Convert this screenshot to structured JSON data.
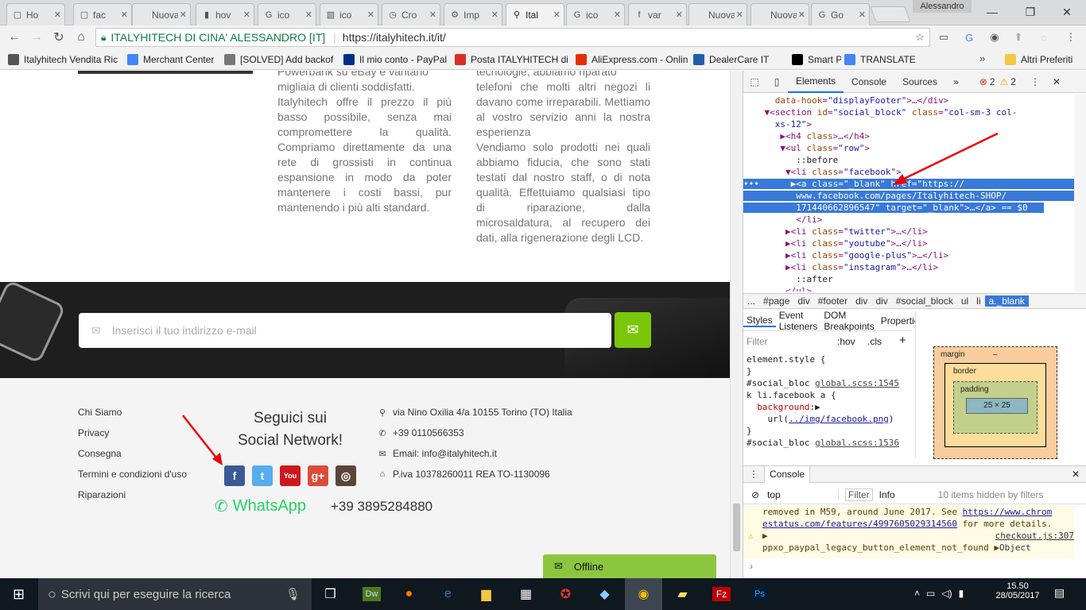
{
  "tabs": [
    {
      "label": "Ho",
      "icon": "page-icon",
      "fav": "▢"
    },
    {
      "label": "fac",
      "icon": "page-icon",
      "fav": "▢"
    },
    {
      "label": "Nuova",
      "icon": "blank-icon",
      "fav": ""
    },
    {
      "label": "hov",
      "icon": "chart-icon",
      "fav": "▮"
    },
    {
      "label": "ico",
      "icon": "google-icon",
      "fav": "G"
    },
    {
      "label": "ico",
      "icon": "image-icon",
      "fav": "▧"
    },
    {
      "label": "Cro",
      "icon": "history-icon",
      "fav": "◷"
    },
    {
      "label": "Imp",
      "icon": "settings-icon",
      "fav": "⚙"
    },
    {
      "label": "Ital",
      "icon": "location-icon",
      "fav": "⚲"
    },
    {
      "label": "ico",
      "icon": "google-icon",
      "fav": "G"
    },
    {
      "label": "var",
      "icon": "facebook-icon",
      "fav": "f"
    },
    {
      "label": "Nuova",
      "icon": "blank-icon",
      "fav": ""
    },
    {
      "label": "Nuova",
      "icon": "blank-icon",
      "fav": ""
    },
    {
      "label": "Go",
      "icon": "translate-icon",
      "fav": "G"
    }
  ],
  "user_label": "Alessandro",
  "omnibox": {
    "secure_label": "ITALYHITECH DI CINA' ALESSANDRO [IT]",
    "url": "https://italyhitech.it/it/"
  },
  "bookmarks": [
    {
      "label": "Italyhitech Vendita Ric",
      "color": "#555"
    },
    {
      "label": "Merchant Center",
      "color": "#4285f4"
    },
    {
      "label": "[SOLVED] Add backof",
      "color": "#777"
    },
    {
      "label": "Il mio conto - PayPal",
      "color": "#003087"
    },
    {
      "label": "Posta ITALYHITECH di",
      "color": "#d93025"
    },
    {
      "label": "AliExpress.com - Onlin",
      "color": "#e62e04"
    },
    {
      "label": "DealerCare IT",
      "color": "#1f5fa6"
    },
    {
      "label": "Smart Pro",
      "color": "#000"
    },
    {
      "label": "TRANSLATE",
      "color": "#4285f4"
    }
  ],
  "bookmarks_other": "Altri Preferiti",
  "content": {
    "col1_top": "Powerbank su eBay e vantano",
    "col1": "migliaia di clienti soddisfatti.\nItalyhitech offre il prezzo il più basso possibile, senza mai compromettere la qualità. Compriamo direttamente da una rete di grossisti in continua espansione in modo da poter mantenere i costi bassi, pur mantenendo i più alti standard.",
    "col2_top": "tecnologie, abbiamo riparato",
    "col2": "telefoni che molti altri negozi li davano come irreparabili. Mettiamo al vostro servizio anni la nostra esperienza\nVendiamo solo prodotti nei quali abbiamo fiducia, che sono stati testati dal nostro staff, o di nota qualità. Effettuiamo qualsiasi tipo di riparazione, dalla microsaldatura, al recupero dei dati, alla rigenerazione degli LCD."
  },
  "newsletter": {
    "placeholder": "Inserisci il tuo indirizzo e-mail"
  },
  "footer": {
    "links": [
      "Chi Siamo",
      "Privacy",
      "Consegna",
      "Termini e condizioni d'uso",
      "Riparazioni"
    ],
    "social_title_1": "Seguici sui",
    "social_title_2": "Social Network!",
    "whatsapp": "WhatsApp",
    "phone_big": "+39 3895284880",
    "contacts": [
      {
        "icon": "pin-icon",
        "glyph": "⚲",
        "text": "via Nino Oxilia 4/a 10155 Torino (TO) Italia"
      },
      {
        "icon": "phone-icon",
        "glyph": "✆",
        "text": "+39 0110566353"
      },
      {
        "icon": "mail-icon",
        "glyph": "✉",
        "text": "Email: info@italyhitech.it"
      },
      {
        "icon": "bank-icon",
        "glyph": "⌂",
        "text": "P.iva 10378260011 REA TO-1130096"
      }
    ]
  },
  "chat": {
    "label": "Offline"
  },
  "devtools": {
    "tabs": [
      "Elements",
      "Console",
      "Sources"
    ],
    "errors": "2",
    "warnings": "2",
    "breadcrumb": [
      "...",
      "#page",
      "div",
      "#footer",
      "div",
      "div",
      "#social_block",
      "ul",
      "li",
      "a._blank"
    ],
    "styles_tabs": [
      "Styles",
      "Event Listeners",
      "DOM Breakpoints",
      "Properties"
    ],
    "filter_placeholder": "Filter",
    "hov": ":hov",
    "cls": ".cls",
    "box": {
      "margin": "margin",
      "border": "border",
      "padding": "padding",
      "size": "25 × 25",
      "dash": "–"
    },
    "console_label": "Console",
    "console_context": "top",
    "console_level": "Info",
    "console_hidden": "10 items hidden by filters",
    "console_msg1": "removed in M59, around June 2017. See",
    "console_link1": "https://www.chrom",
    "console_link2": "estatus.com/features/4997605029314560",
    "console_msg1b": "for more details.",
    "console_src": "checkout.js:307",
    "console_warn": "ppxo_paypal_legacy_button_element_not_found",
    "console_obj": "Object"
  },
  "taskbar": {
    "search": "Scrivi qui per eseguire la ricerca",
    "time": "15.50",
    "date": "28/05/2017"
  }
}
